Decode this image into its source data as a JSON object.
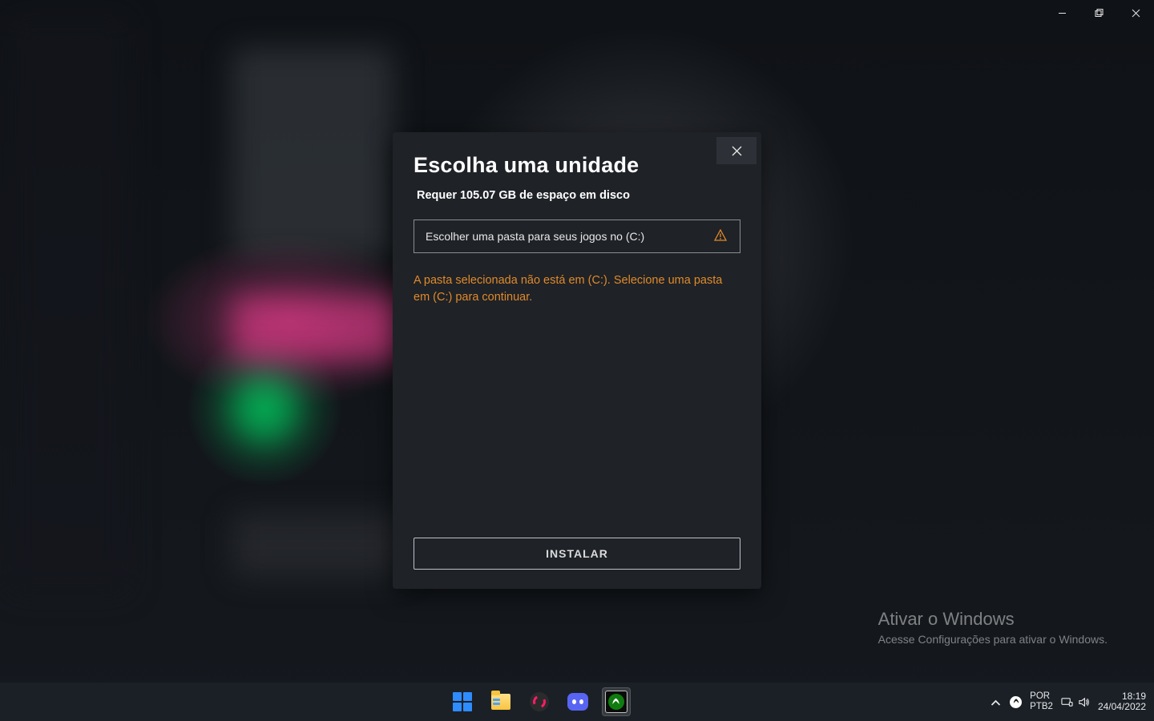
{
  "window_controls": {
    "minimize": "minimize",
    "maximize": "maximize",
    "close": "close"
  },
  "dialog": {
    "title": "Escolha uma unidade",
    "subtitle": "Requer 105.07 GB de espaço em disco",
    "folder_select_label": "Escolher uma pasta para seus jogos no (C:)",
    "error": "A pasta selecionada não está em (C:). Selecione uma pasta em (C:) para continuar.",
    "install_label": "INSTALAR"
  },
  "watermark": {
    "line1": "Ativar o Windows",
    "line2": "Acesse Configurações para ativar o Windows."
  },
  "taskbar": {
    "lang_top": "POR",
    "lang_bottom": "PTB2",
    "time": "18:19",
    "date": "24/04/2022"
  }
}
